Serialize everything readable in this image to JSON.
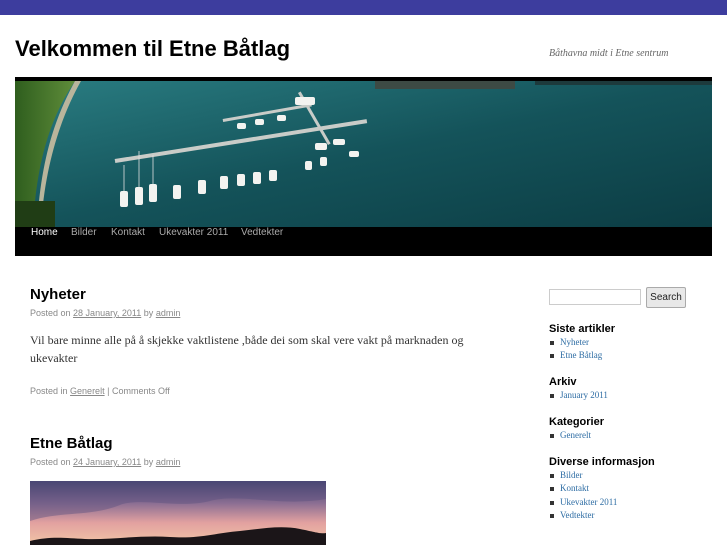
{
  "site": {
    "title": "Velkommen til Etne Båtlag",
    "description": "Båthavna midt i Etne sentrum"
  },
  "nav": [
    {
      "label": "Home",
      "current": true
    },
    {
      "label": "Bilder"
    },
    {
      "label": "Kontakt"
    },
    {
      "label": "Ukevakter 2011"
    },
    {
      "label": "Vedtekter"
    }
  ],
  "posts": [
    {
      "title": "Nyheter",
      "posted_on": "Posted on",
      "date": "28 January, 2011",
      "by": "by",
      "author": "admin",
      "body": "Vil bare minne alle på å skjekke vaktlistene ,både dei som skal vere vakt på marknaden og ukevakter",
      "footer_prefix": "Posted in",
      "category": "Generelt",
      "comments": "Comments Off"
    },
    {
      "title": "Etne Båtlag",
      "posted_on": "Posted on",
      "date": "24 January, 2011",
      "by": "by",
      "author": "admin"
    }
  ],
  "sidebar": {
    "search_button": "Search",
    "widgets": [
      {
        "title": "Siste artikler",
        "items": [
          "Nyheter",
          "Etne Båtlag"
        ]
      },
      {
        "title": "Arkiv",
        "items": [
          "January 2011"
        ]
      },
      {
        "title": "Kategorier",
        "items": [
          "Generelt"
        ]
      },
      {
        "title": "Diverse informasjon",
        "items": [
          "Bilder",
          "Kontakt",
          "Ukevakter 2011",
          "Vedtekter"
        ]
      }
    ]
  },
  "colors": {
    "topbar": "#3d3d9e",
    "link": "#2e6da4",
    "menu_bg": "#000000",
    "water": "#1a5c63"
  }
}
